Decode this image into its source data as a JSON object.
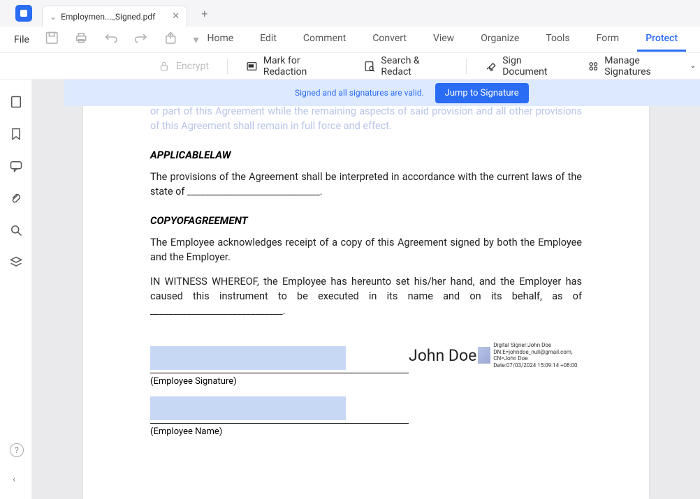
{
  "titlebar": {
    "tab_name": "Employmen..._Signed.pdf"
  },
  "menu": {
    "file": "File",
    "tabs": [
      "Home",
      "Edit",
      "Comment",
      "Convert",
      "View",
      "Organize",
      "Tools",
      "Form",
      "Protect"
    ],
    "active_index": 8
  },
  "ribbon": {
    "encrypt": "Encrypt",
    "mark_redaction": "Mark for Redaction",
    "search_redact": "Search & Redact",
    "sign_document": "Sign Document",
    "manage_signatures": "Manage Signatures"
  },
  "banner": {
    "text": "Signed and all signatures are valid.",
    "button": "Jump to Signature"
  },
  "document": {
    "para1": "part or in whole, such invalidity or unenforceability shall attach only to that particular provision or part of this Agreement while the remaining aspects of said provision and all other provisions of this Agreement shall remain in full force and effect.",
    "heading1": "APPLICABLELAW",
    "para2": "The provisions of the Agreement shall be interpreted in accordance with the current laws of the state of _____________________________.",
    "heading2": "COPYOFAGREEMENT",
    "para3": "The Employee acknowledges receipt of a copy of this Agreement signed by both the Employee and the Employer.",
    "para4": "IN WITNESS WHEREOF, the Employee has hereunto set his/her hand, and the Employer has caused this instrument to be executed in its name and on its behalf, as of _____________________________.",
    "sig1_label": "(Employee Signature)",
    "sig2_label": "(Employee Name)",
    "signer_name": "John Doe",
    "sig_meta_line1": "Digital Signer:John Doe",
    "sig_meta_line2": "DN:E=johndoe_null@gmail.com,",
    "sig_meta_line3": "CN=John Doe",
    "sig_meta_line4": "Date:07/03/2024 15:09:14 +08:00"
  }
}
